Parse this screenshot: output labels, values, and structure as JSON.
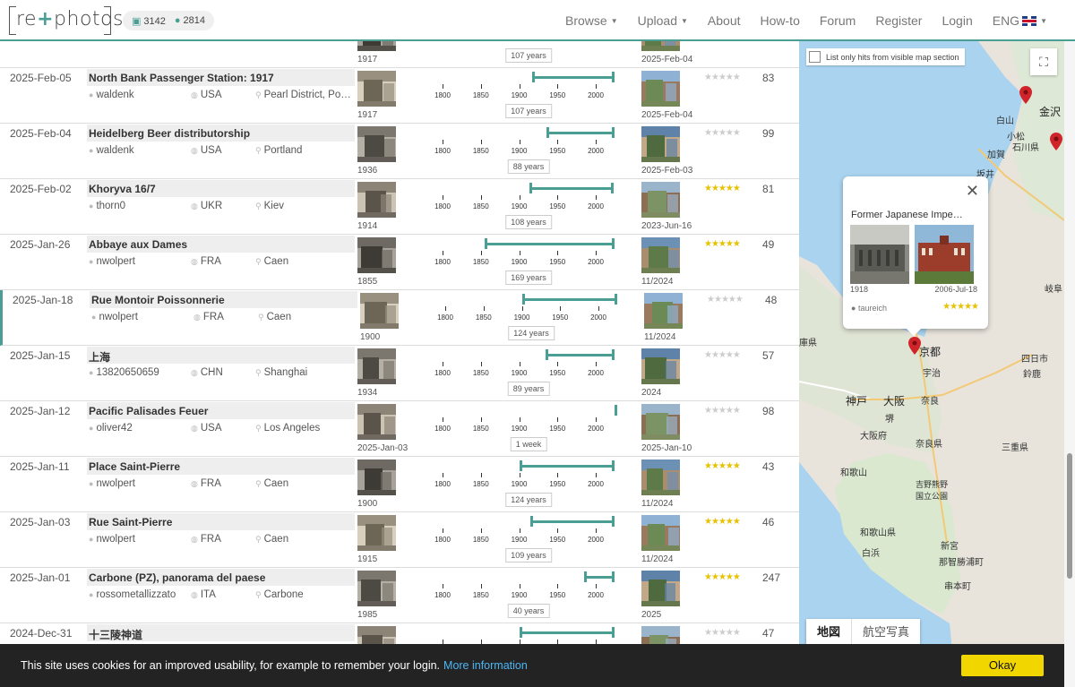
{
  "header": {
    "logo_text_left": "re",
    "logo_text_right": "photos",
    "stat_photos": "3142",
    "stat_users": "2814",
    "nav": [
      {
        "label": "Browse",
        "dropdown": true
      },
      {
        "label": "Upload",
        "dropdown": true
      },
      {
        "label": "About",
        "dropdown": false
      },
      {
        "label": "How-to",
        "dropdown": false
      },
      {
        "label": "Forum",
        "dropdown": false
      },
      {
        "label": "Register",
        "dropdown": false
      },
      {
        "label": "Login",
        "dropdown": false
      }
    ],
    "language": "ENG"
  },
  "timeline_ticks": [
    "1800",
    "1850",
    "1900",
    "1950",
    "2000"
  ],
  "top_partial": {
    "old_label": "1917",
    "years": "107 years",
    "new_label": "2025-Feb-04"
  },
  "rows": [
    {
      "date": "2025-Feb-05",
      "title": "North Bank Passenger Station: 1917",
      "user": "waldenk",
      "country": "USA",
      "city": "Pearl District, Portland",
      "old_label": "1917",
      "new_label": "2025-Feb-04",
      "years": "107 years",
      "start_year": 1917,
      "end_year": 2025,
      "rating": 0,
      "score": "83",
      "active": false
    },
    {
      "date": "2025-Feb-04",
      "title": "Heidelberg Beer distributorship",
      "user": "waldenk",
      "country": "USA",
      "city": "Portland",
      "old_label": "1936",
      "new_label": "2025-Feb-03",
      "years": "88 years",
      "start_year": 1936,
      "end_year": 2025,
      "rating": 0,
      "score": "99",
      "active": false
    },
    {
      "date": "2025-Feb-02",
      "title": "Khoryva 16/7",
      "user": "thorn0",
      "country": "UKR",
      "city": "Kiev",
      "old_label": "1914",
      "new_label": "2023-Jun-16",
      "years": "108 years",
      "start_year": 1914,
      "end_year": 2023,
      "rating": 5,
      "score": "81",
      "active": false
    },
    {
      "date": "2025-Jan-26",
      "title": "Abbaye aux Dames",
      "user": "nwolpert",
      "country": "FRA",
      "city": "Caen",
      "old_label": "1855",
      "new_label": "11/2024",
      "years": "169 years",
      "start_year": 1855,
      "end_year": 2024,
      "rating": 5,
      "score": "49",
      "active": false
    },
    {
      "date": "2025-Jan-18",
      "title": "Rue Montoir Poissonnerie",
      "user": "nwolpert",
      "country": "FRA",
      "city": "Caen",
      "old_label": "1900",
      "new_label": "11/2024",
      "years": "124 years",
      "start_year": 1900,
      "end_year": 2024,
      "rating": 0,
      "score": "48",
      "active": true
    },
    {
      "date": "2025-Jan-15",
      "title": "上海",
      "user": "13820650659",
      "country": "CHN",
      "city": "Shanghai",
      "old_label": "1934",
      "new_label": "2024",
      "years": "89 years",
      "start_year": 1934,
      "end_year": 2024,
      "rating": 0,
      "score": "57",
      "active": false
    },
    {
      "date": "2025-Jan-12",
      "title": "Pacific Palisades Feuer",
      "user": "oliver42",
      "country": "USA",
      "city": "Los Angeles",
      "old_label": "2025-Jan-03",
      "new_label": "2025-Jan-10",
      "years": "1 week",
      "start_year": 2025,
      "end_year": 2025,
      "rating": 0,
      "score": "98",
      "active": false
    },
    {
      "date": "2025-Jan-11",
      "title": "Place Saint-Pierre",
      "user": "nwolpert",
      "country": "FRA",
      "city": "Caen",
      "old_label": "1900",
      "new_label": "11/2024",
      "years": "124 years",
      "start_year": 1900,
      "end_year": 2024,
      "rating": 5,
      "score": "43",
      "active": false
    },
    {
      "date": "2025-Jan-03",
      "title": "Rue Saint-Pierre",
      "user": "nwolpert",
      "country": "FRA",
      "city": "Caen",
      "old_label": "1915",
      "new_label": "11/2024",
      "years": "109 years",
      "start_year": 1915,
      "end_year": 2024,
      "rating": 5,
      "score": "46",
      "active": false
    },
    {
      "date": "2025-Jan-01",
      "title": "Carbone (PZ), panorama del paese",
      "user": "rossometallizzato",
      "country": "ITA",
      "city": "Carbone",
      "old_label": "1985",
      "new_label": "2025",
      "years": "40 years",
      "start_year": 1985,
      "end_year": 2025,
      "rating": 5,
      "score": "247",
      "active": false
    },
    {
      "date": "2024-Dec-31",
      "title": "十三陵神道",
      "user": "",
      "country": "",
      "city": "",
      "old_label": "",
      "new_label": "",
      "years": "",
      "start_year": 1900,
      "end_year": 2024,
      "rating": 0,
      "score": "47",
      "active": false
    }
  ],
  "map": {
    "checkbox_label": "List only hits from visible map section",
    "popup": {
      "title": "Former Japanese Impe…",
      "old_label": "1918",
      "new_label": "2006-Jul-18",
      "user": "taureich",
      "rating": 5
    },
    "labels": [
      {
        "text": "金沢",
        "big": true
      },
      {
        "text": "石川県",
        "big": false
      },
      {
        "text": "白山",
        "big": false
      },
      {
        "text": "小松",
        "big": false
      },
      {
        "text": "加賀",
        "big": false
      },
      {
        "text": "坂井",
        "big": false
      },
      {
        "text": "京都",
        "big": true
      },
      {
        "text": "宇治",
        "big": false
      },
      {
        "text": "神戸",
        "big": true
      },
      {
        "text": "大阪",
        "big": true
      },
      {
        "text": "奈良",
        "big": false
      },
      {
        "text": "堺",
        "big": false
      },
      {
        "text": "大阪府",
        "big": false
      },
      {
        "text": "奈良県",
        "big": false
      },
      {
        "text": "和歌山",
        "big": false
      },
      {
        "text": "和歌山県",
        "big": false
      },
      {
        "text": "三重県",
        "big": false
      },
      {
        "text": "岐阜",
        "big": false
      },
      {
        "text": "四日市",
        "big": false
      },
      {
        "text": "鈴鹿",
        "big": false
      },
      {
        "text": "庫県",
        "big": false
      },
      {
        "text": "白浜",
        "big": false
      },
      {
        "text": "新宮",
        "big": false
      },
      {
        "text": "那智勝浦町",
        "big": false
      },
      {
        "text": "串本町",
        "big": false
      },
      {
        "text": "吉野熊野国立公園",
        "big": false
      }
    ],
    "maptype": [
      "地図",
      "航空写真"
    ]
  },
  "cookie": {
    "text": "This site uses cookies for an improved usability, for example to remember your login.",
    "link": "More information",
    "button": "Okay"
  },
  "colors": {
    "accent": "#4a9e93",
    "star": "#e6c200",
    "cookie_button": "#f1d600"
  }
}
